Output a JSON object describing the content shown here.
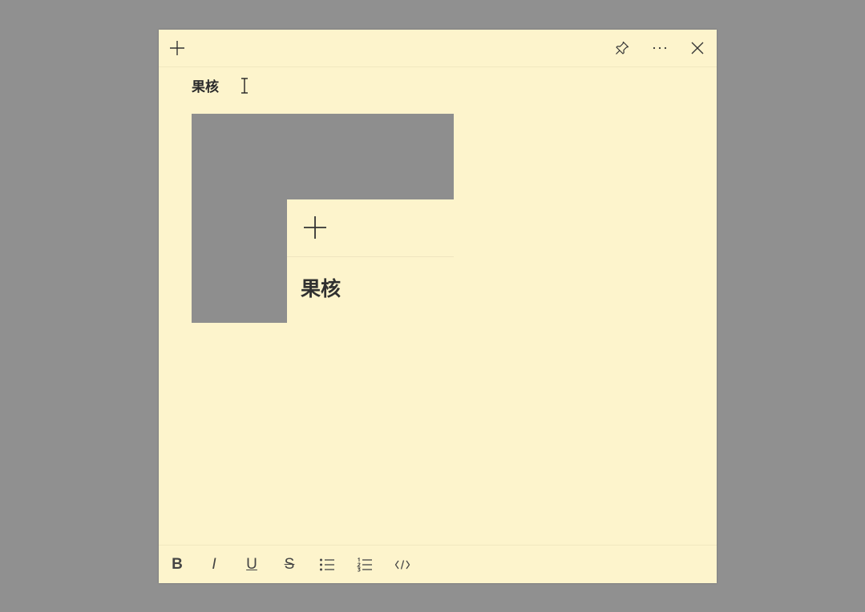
{
  "note": {
    "title_text": "果核",
    "background_color": "#fdf4cc"
  },
  "titlebar": {
    "new_note_icon": "plus-icon",
    "pin_icon": "pin-icon",
    "menu_icon": "more-icon",
    "close_icon": "close-icon"
  },
  "embedded_image": {
    "title_text": "果核",
    "icon": "plus-icon"
  },
  "toolbar": {
    "bold_label": "B",
    "italic_label": "I",
    "underline_label": "U",
    "strikethrough_label": "S",
    "bullets_icon": "bullet-list-icon",
    "numbered_icon": "numbered-list-icon",
    "code_icon": "code-icon"
  }
}
